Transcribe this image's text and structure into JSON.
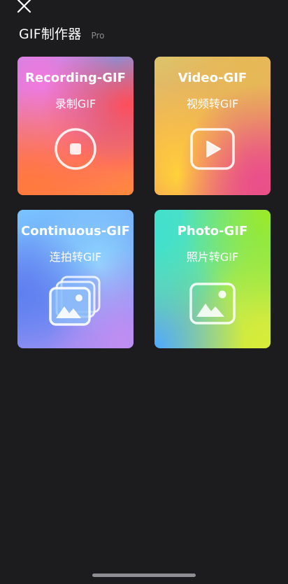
{
  "header": {
    "title": "GIF制作器",
    "badge": "Pro"
  },
  "cards": [
    {
      "title": "Recording-GIF",
      "subtitle": "录制GIF",
      "icon": "record-stop-icon"
    },
    {
      "title": "Video-GIF",
      "subtitle": "视频转GIF",
      "icon": "video-play-icon"
    },
    {
      "title": "Continuous-GIF",
      "subtitle": "连拍转GIF",
      "icon": "image-stack-icon"
    },
    {
      "title": "Photo-GIF",
      "subtitle": "照片转GIF",
      "icon": "image-icon"
    }
  ],
  "icons": {
    "close": "close-icon"
  },
  "colors": {
    "background": "#1c1c1e",
    "text": "#ffffff",
    "muted": "#8a8a8e"
  }
}
